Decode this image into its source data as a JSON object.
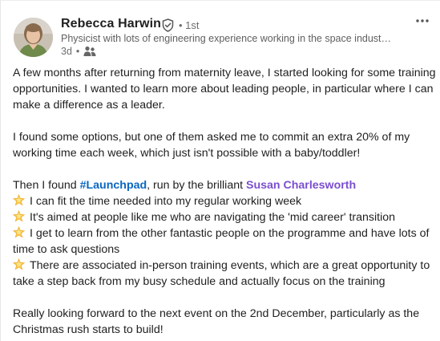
{
  "post": {
    "author": {
      "name": "Rebecca Harwin",
      "degree": "• 1st",
      "headline": "Physicist with lots of engineering experience working in the space indust…",
      "time": "3d",
      "separator": "•"
    },
    "body": {
      "p1": "A few months after returning from maternity leave, I started looking for some training opportunities. I wanted to learn more about leading people, in particular where I can make a difference as a leader.",
      "p2": "I found some options, but one of them asked me to commit an extra 20% of my working time each week, which just isn't possible with a baby/toddler!",
      "p3_prefix": "Then I found ",
      "hashtag": "#Launchpad",
      "p3_middle": ", run by the brilliant ",
      "mention": "Susan Charlesworth",
      "bullets": [
        "I can fit the time needed into my regular working week",
        "It's aimed at people like me who are navigating the 'mid career' transition",
        "I get to learn from the other fantastic people on the programme and have lots of time to ask questions",
        "There are associated in-person training events, which are a great opportunity to take a step back from my busy schedule and actually focus on the training"
      ],
      "closing": "Really looking forward to the next event on the 2nd December, particularly as the Christmas rush starts to build!"
    },
    "icons": {
      "verified": "verified-shield-icon",
      "audience": "connections-audience-icon",
      "menu": "more-options-icon",
      "bullet": "glowing-star-emoji"
    },
    "colors": {
      "hashtag": "#0a66c2",
      "mention": "#7a4fd0",
      "text": "#1f1f1f",
      "secondary": "#6e6e6e"
    }
  }
}
